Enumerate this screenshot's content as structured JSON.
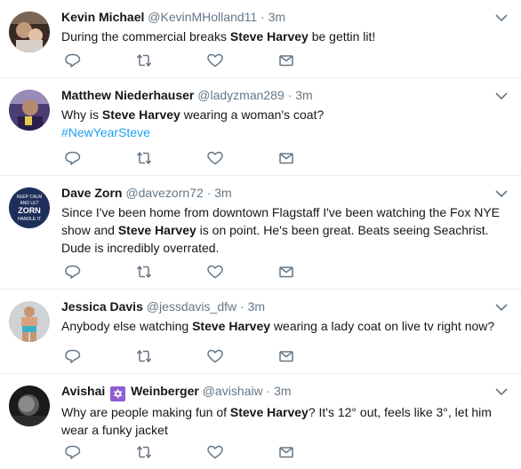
{
  "tweets": [
    {
      "name": "Kevin Michael",
      "handle": "@KevinMHolland11",
      "separator": "·",
      "time": "3m",
      "avatar_icon": "avatar-person-baby",
      "text_parts": [
        "During the commercial breaks ",
        "Steve Harvey",
        " be gettin lit!"
      ]
    },
    {
      "name": "Matthew Niederhauser",
      "handle": "@ladyzman289",
      "separator": "·",
      "time": "3m",
      "avatar_icon": "avatar-person-purple",
      "text_parts": [
        "Why is ",
        "Steve Harvey",
        " wearing a woman's coat?"
      ],
      "hashtag": "#NewYearSteve"
    },
    {
      "name": "Dave Zorn",
      "handle": "@davezorn72",
      "separator": "·",
      "time": "3m",
      "avatar_icon": "avatar-zorn-badge",
      "avatar_text": [
        "KEEP CALM",
        "AND LET",
        "ZORN",
        "HANDLE IT"
      ],
      "text_parts": [
        "Since I've been home from downtown Flagstaff I've been watching the Fox NYE show and ",
        "Steve Harvey",
        " is on point.  He's been great.  Beats seeing Seachrist.  Dude is incredibly overrated."
      ]
    },
    {
      "name": "Jessica Davis",
      "handle": "@jessdavis_dfw",
      "separator": "·",
      "time": "3m",
      "avatar_icon": "avatar-person-fitness",
      "text_parts": [
        "Anybody else watching ",
        "Steve Harvey",
        " wearing a lady coat on live tv right now?"
      ]
    },
    {
      "name_first": "Avishai",
      "name_emoji": "✡",
      "name_last": "Weinberger",
      "handle": "@avishaiw",
      "separator": "·",
      "time": "3m",
      "avatar_icon": "avatar-person-bw",
      "text_parts": [
        "Why are people making fun of ",
        "Steve Harvey",
        "? It's 12° out, feels like 3°, let him wear a funky jacket"
      ]
    }
  ],
  "icons": {
    "reply": "reply-icon",
    "retweet": "retweet-icon",
    "like": "heart-icon",
    "dm": "envelope-icon",
    "more": "chevron-down-icon"
  },
  "colors": {
    "text": "#14171a",
    "secondary": "#657786",
    "link": "#1da1f2",
    "icon": "#657786",
    "divider": "#e6ecf0"
  }
}
